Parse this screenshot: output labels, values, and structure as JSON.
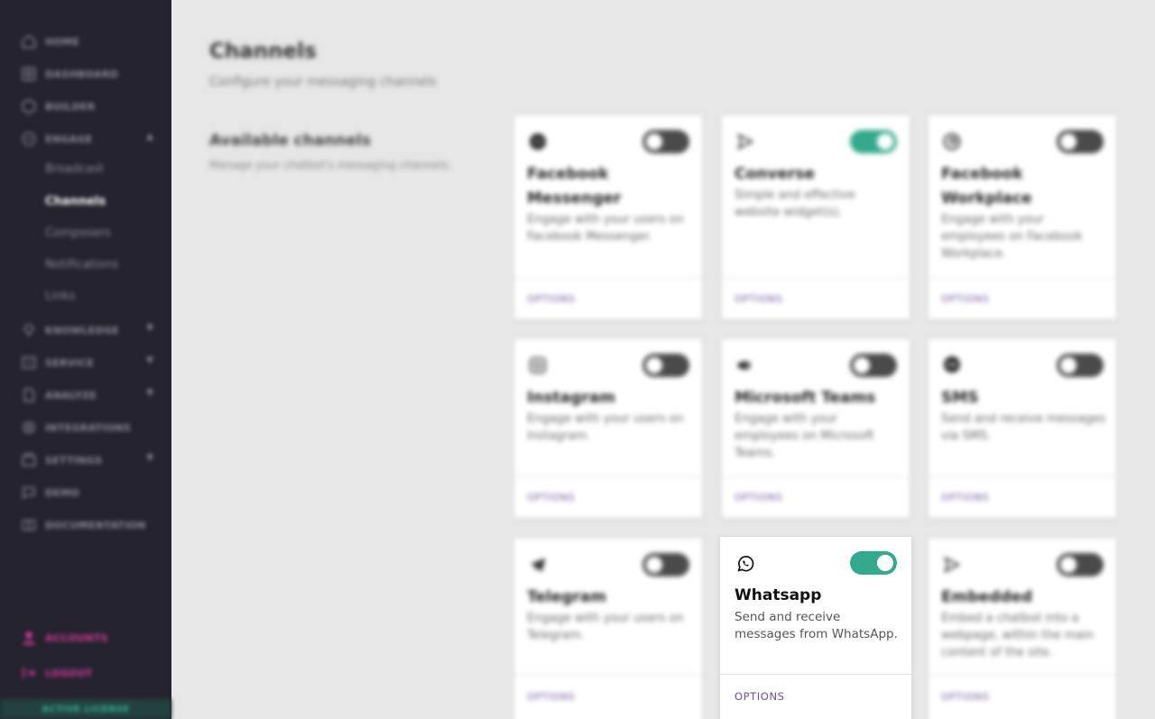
{
  "sidebar": {
    "items": [
      {
        "label": "HOME",
        "icon": "home-icon"
      },
      {
        "label": "DASHBOARD",
        "icon": "dashboard-icon"
      },
      {
        "label": "BUILDER",
        "icon": "builder-icon"
      },
      {
        "label": "ENGAGE",
        "icon": "engage-icon",
        "expanded": true
      },
      {
        "label": "KNOWLEDGE",
        "icon": "knowledge-icon"
      },
      {
        "label": "SERVICE",
        "icon": "service-icon"
      },
      {
        "label": "ANALYZE",
        "icon": "analyze-icon"
      },
      {
        "label": "INTEGRATIONS",
        "icon": "integrations-icon"
      },
      {
        "label": "SETTINGS",
        "icon": "settings-icon"
      },
      {
        "label": "DEMO",
        "icon": "demo-icon"
      },
      {
        "label": "DOCUMENTATION",
        "icon": "documentation-icon"
      }
    ],
    "engage_sub": [
      "Broadcast",
      "Channels",
      "Composers",
      "Notifications",
      "Links"
    ],
    "accounts_label": "ACCOUNTS",
    "logout_label": "LOGOUT",
    "license_label": "ACTIVE LICENSE"
  },
  "main": {
    "title": "Channels",
    "subtitle": "Configure your messaging channels",
    "section_title": "Available channels",
    "section_subtitle": "Manage your chatbot's messaging channels."
  },
  "channels": [
    {
      "name": "Facebook Messenger",
      "desc": "Engage with your users on Facebook Messenger.",
      "enabled": false,
      "icon": "messenger-icon",
      "options": "OPTIONS"
    },
    {
      "name": "Converse",
      "desc": "Simple and effective website widget(s).",
      "enabled": true,
      "icon": "send-icon",
      "options": "OPTIONS"
    },
    {
      "name": "Facebook Workplace",
      "desc": "Engage with your employees on Facebook Workplace.",
      "enabled": false,
      "icon": "workplace-icon",
      "options": "OPTIONS"
    },
    {
      "name": "Instagram",
      "desc": "Engage with your users on Instagram.",
      "enabled": false,
      "icon": "instagram-icon",
      "options": "OPTIONS"
    },
    {
      "name": "Microsoft Teams",
      "desc": "Engage with your employees on Microsoft Teams.",
      "enabled": false,
      "icon": "teams-icon",
      "options": "OPTIONS"
    },
    {
      "name": "SMS",
      "desc": "Send and receive messages via SMS.",
      "enabled": false,
      "icon": "sms-icon",
      "options": "OPTIONS"
    },
    {
      "name": "Telegram",
      "desc": "Engage with your users on Telegram.",
      "enabled": false,
      "icon": "telegram-icon",
      "options": "OPTIONS"
    },
    {
      "name": "Whatsapp",
      "desc": "Send and receive messages from WhatsApp.",
      "enabled": true,
      "icon": "whatsapp-icon",
      "options": "OPTIONS"
    },
    {
      "name": "Embedded",
      "desc": "Embed a chatbot into a webpage, within the main content of the site.",
      "enabled": false,
      "icon": "send-icon",
      "options": "OPTIONS"
    }
  ],
  "colors": {
    "sidebar_bg": "#25232f",
    "toggle_on": "#34a98d",
    "toggle_off": "#4a4a4a",
    "options_link": "#6c4f96",
    "accent_pink": "#d63a9c",
    "license_green": "#35b79a"
  }
}
